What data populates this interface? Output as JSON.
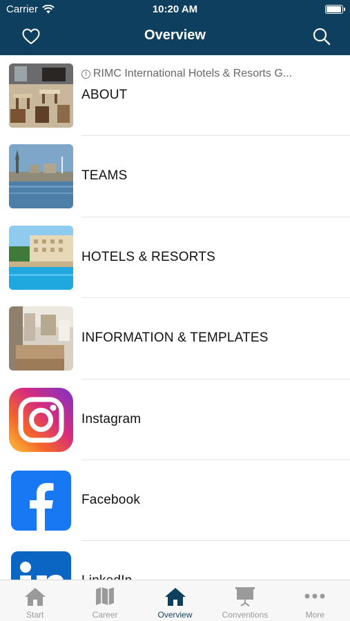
{
  "status_bar": {
    "carrier": "Carrier",
    "time": "10:20 AM"
  },
  "nav": {
    "title": "Overview"
  },
  "list": [
    {
      "label": "ABOUT",
      "subtitle": "RIMC International Hotels & Resorts G..."
    },
    {
      "label": "TEAMS"
    },
    {
      "label": "HOTELS & RESORTS"
    },
    {
      "label": "INFORMATION & TEMPLATES"
    },
    {
      "label": "Instagram"
    },
    {
      "label": "Facebook"
    },
    {
      "label": "LinkedIn"
    }
  ],
  "tabs": [
    {
      "label": "Start",
      "icon": "home-icon"
    },
    {
      "label": "Career",
      "icon": "map-icon"
    },
    {
      "label": "Overview",
      "icon": "home-icon",
      "active": true
    },
    {
      "label": "Conventions",
      "icon": "presentation-icon"
    },
    {
      "label": "More",
      "icon": "more-icon"
    }
  ],
  "colors": {
    "header": "#0f3f5e",
    "active_tab": "#0f3f5e",
    "inactive_tab": "#9a9a9a"
  }
}
